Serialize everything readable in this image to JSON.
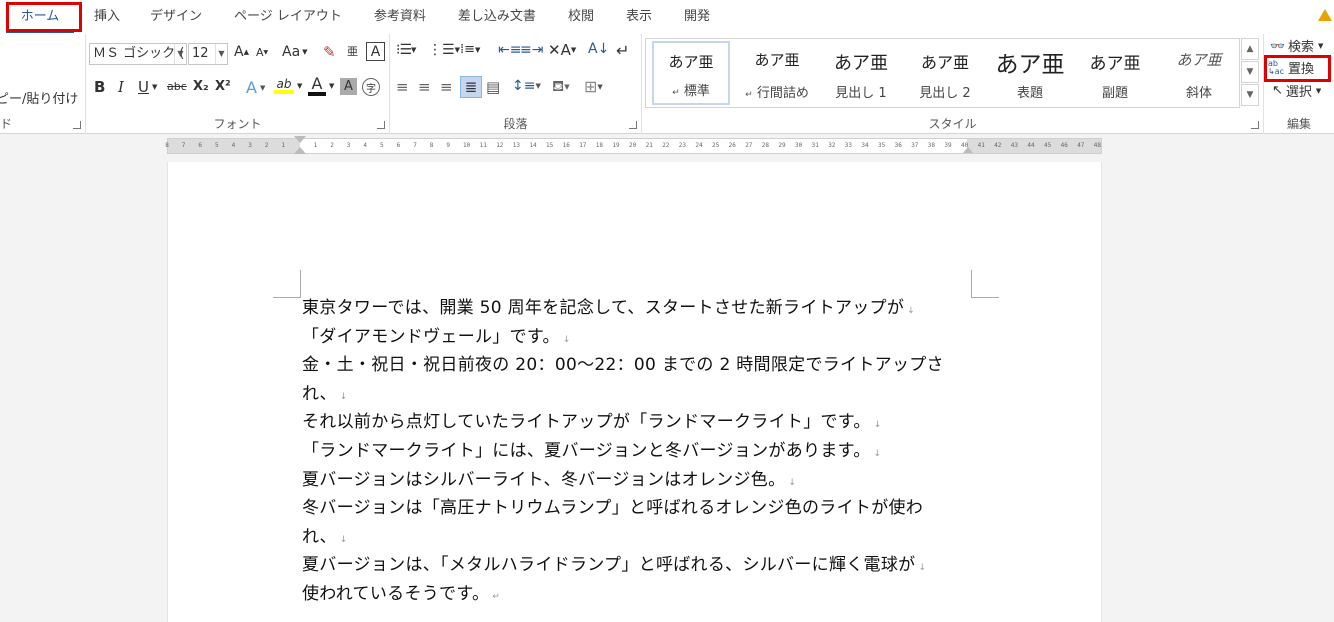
{
  "tabs": [
    "ホーム",
    "挿入",
    "デザイン",
    "ページ レイアウト",
    "参考資料",
    "差し込み文書",
    "校閲",
    "表示",
    "開発"
  ],
  "clipboard": {
    "paste_label": "ピー/貼り付け",
    "group_label": "ド"
  },
  "font": {
    "name": "ＭＳ ゴシック (",
    "size": "12",
    "group_label": "フォント",
    "grow": "A",
    "shrink": "A",
    "case": "Aa",
    "bold": "B",
    "italic": "I",
    "underline": "U",
    "strike": "abc",
    "sub": "X₂",
    "sup": "X²",
    "text_effect": "A",
    "highlight": "ab",
    "color": "A",
    "shade": "A",
    "enclose": "字",
    "ruby": "亜",
    "border_char": "A"
  },
  "paragraph": {
    "group_label": "段落"
  },
  "styles": {
    "group_label": "スタイル",
    "items": [
      {
        "preview": "あア亜",
        "name": "標準",
        "mark": "↵"
      },
      {
        "preview": "あア亜",
        "name": "行間詰め",
        "mark": "↵"
      },
      {
        "preview": "あア亜",
        "name": "見出し 1",
        "mark": ""
      },
      {
        "preview": "あア亜",
        "name": "見出し 2",
        "mark": ""
      },
      {
        "preview": "あア亜",
        "name": "表題",
        "mark": ""
      },
      {
        "preview": "あア亜",
        "name": "副題",
        "mark": ""
      },
      {
        "preview": "あア亜",
        "name": "斜体",
        "mark": ""
      }
    ]
  },
  "editing": {
    "group_label": "編集",
    "find": "検索",
    "replace": "置換",
    "select": "選択"
  },
  "ruler": {
    "left_ticks": [
      "8",
      "7",
      "6",
      "5",
      "4",
      "3",
      "2",
      "1"
    ],
    "right_ticks": [
      "1",
      "2",
      "3",
      "4",
      "5",
      "6",
      "7",
      "8",
      "9",
      "10",
      "11",
      "12",
      "13",
      "14",
      "15",
      "16",
      "17",
      "18",
      "19",
      "20",
      "21",
      "22",
      "23",
      "24",
      "25",
      "26",
      "27",
      "28",
      "29",
      "30",
      "31",
      "32",
      "33",
      "34",
      "35",
      "36",
      "37",
      "38",
      "39",
      "40",
      "41",
      "42",
      "43",
      "44",
      "45",
      "46",
      "47",
      "48"
    ]
  },
  "document": {
    "lines": [
      "東京タワーでは、開業 50 周年を記念して、スタートさせた新ライトアップが",
      "「ダイアモンドヴェール」です。",
      "金・土・祝日・祝日前夜の 20：00～22：00 までの 2 時間限定でライトアップさ",
      "れ、",
      "それ以前から点灯していたライトアップが「ランドマークライト」です。",
      "「ランドマークライト」には、夏バージョンと冬バージョンがあります。",
      "夏バージョンはシルバーライト、冬バージョンはオレンジ色。",
      "冬バージョンは「高圧ナトリウムランプ」と呼ばれるオレンジ色のライトが使わ",
      "れ、",
      "夏バージョンは、「メタルハライドランプ」と呼ばれる、シルバーに輝く電球が",
      "使われているそうです。"
    ],
    "marks": [
      "↓",
      "↓",
      "",
      "↓",
      "↓",
      "↓",
      "↓",
      "",
      "↓",
      "↓",
      "↵"
    ]
  },
  "colors": {
    "accent": "#2b579a",
    "highlight_red": "#e00000"
  }
}
